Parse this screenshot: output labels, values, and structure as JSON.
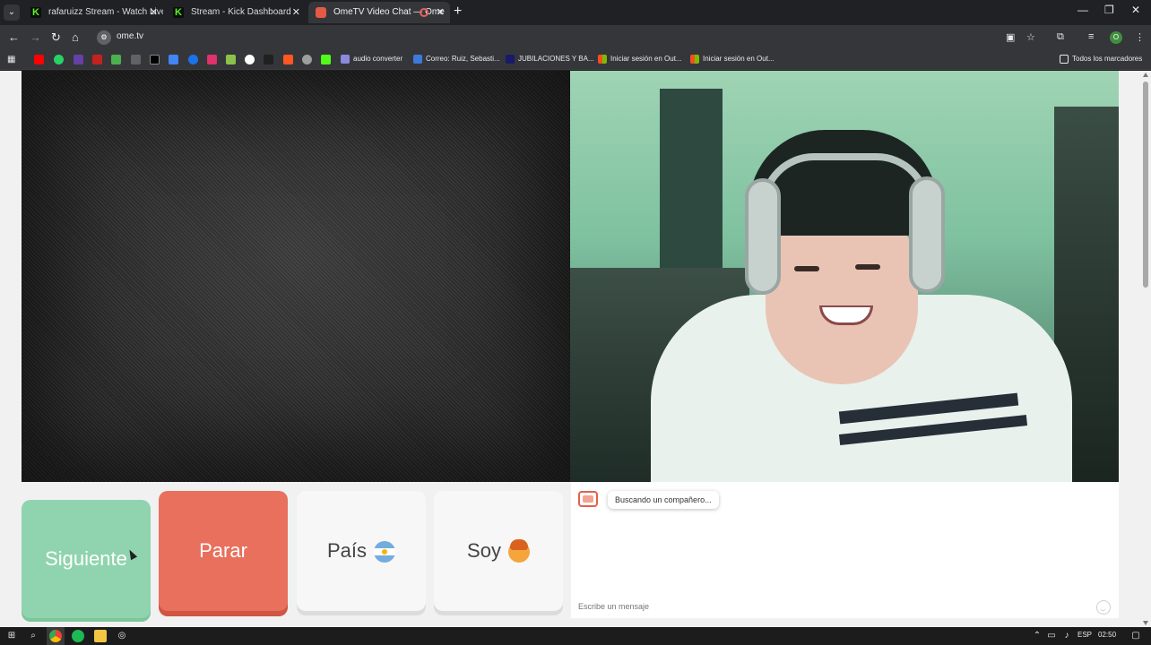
{
  "browser": {
    "tabs": [
      {
        "title": "rafaruizz Stream - Watch Live o",
        "icon": "kick-icon"
      },
      {
        "title": "Stream - Kick Dashboard",
        "icon": "kick-icon"
      },
      {
        "title": "OmeTV Video Chat — Ome",
        "icon": "ometv-icon"
      }
    ],
    "url": "ome.tv",
    "bookmarks": [
      {
        "label": "audio converter",
        "color": "#8a8ae0"
      },
      {
        "label": "Correo: Ruiz, Sebasti...",
        "color": "#3c7bd9"
      },
      {
        "label": "JUBILACIONES Y BA...",
        "color": "#1a1a6a"
      },
      {
        "label": "Iniciar sesión en Out...",
        "color": "#f25022"
      },
      {
        "label": "Iniciar sesión en Out...",
        "color": "#f25022"
      }
    ],
    "all_bookmarks_label": "Todos los marcadores"
  },
  "controls": {
    "next_label": "Siguiente",
    "stop_label": "Parar",
    "country_label": "País",
    "gender_label": "Soy"
  },
  "chat": {
    "status_message": "Buscando un compañero...",
    "input_placeholder": "Escribe un mensaje"
  },
  "taskbar": {
    "language": "ESP",
    "time": "02:50"
  },
  "colors": {
    "next": "#8fd4ae",
    "stop": "#e8705d",
    "neutral_button": "#f7f7f7"
  }
}
